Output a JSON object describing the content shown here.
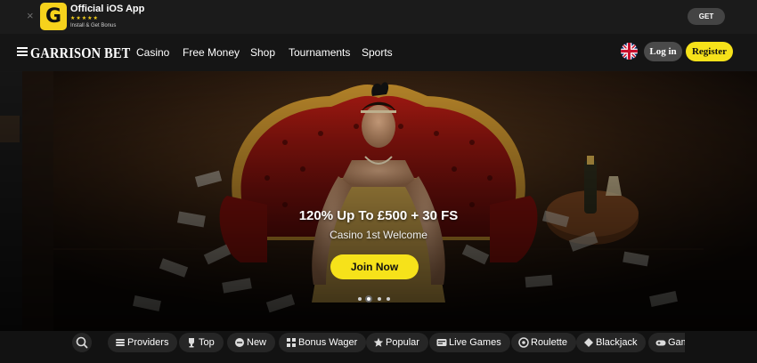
{
  "app_banner": {
    "close": "×",
    "logo_letter": "G",
    "title": "Official iOS App",
    "stars": "★★★★★",
    "subtitle": "Install & Get Bonus",
    "get_label": "GET"
  },
  "header": {
    "brand": "GARRISON BET",
    "nav": [
      "Casino",
      "Free Money",
      "Shop",
      "Tournaments",
      "Sports"
    ],
    "login_label": "Log in",
    "register_label": "Register"
  },
  "hero": {
    "headline": "120% Up To £500 + 30 FS",
    "subtitle": "Casino 1st Welcome",
    "cta_label": "Join Now",
    "slide_count": 4,
    "active_slide": 2
  },
  "categories": [
    {
      "label": "Providers",
      "icon": "providers-icon"
    },
    {
      "label": "Top",
      "icon": "trophy-icon"
    },
    {
      "label": "New",
      "icon": "new-badge-icon"
    },
    {
      "label": "Bonus Wager",
      "icon": "grid-icon"
    },
    {
      "label": "Popular",
      "icon": "star-icon"
    },
    {
      "label": "Live Games",
      "icon": "live-tv-icon"
    },
    {
      "label": "Roulette",
      "icon": "roulette-icon"
    },
    {
      "label": "Blackjack",
      "icon": "blackjack-icon"
    },
    {
      "label": "Gam",
      "icon": "gamepad-icon"
    }
  ],
  "colors": {
    "accent_yellow": "#f6e21a",
    "background": "#141414",
    "chip": "#262626"
  }
}
